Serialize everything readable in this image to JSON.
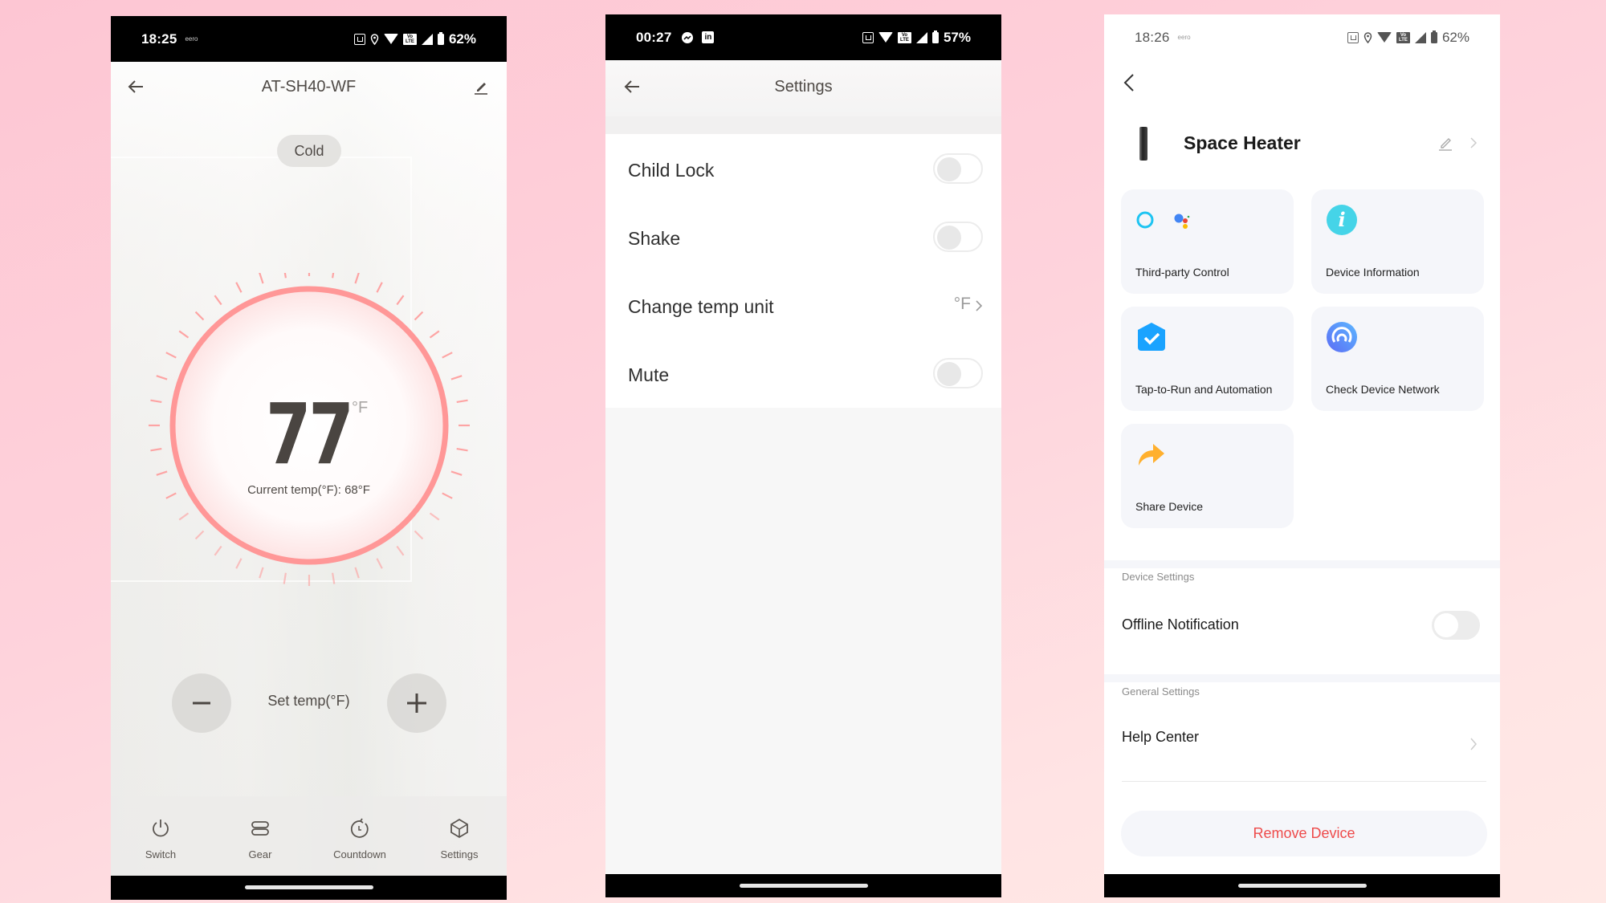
{
  "colors": {
    "accent_ring": "#ff9797",
    "danger": "#ee4a4a",
    "card_bg": "#f5f6fa"
  },
  "screens": [
    {
      "status_bar": {
        "time": "18:25",
        "carrier": "eero",
        "battery": "62%",
        "icons": [
          "nfc-icon",
          "location-icon",
          "wifi-icon",
          "volte-icon",
          "signal-icon",
          "battery-icon"
        ]
      },
      "header": {
        "title": "AT-SH40-WF",
        "back_icon": "back-arrow-icon",
        "edit_icon": "edit-pencil-icon"
      },
      "mode_badge": "Cold",
      "dial": {
        "set_temp": "77",
        "unit": "°F",
        "current_label": "Current temp(°F): 68°F",
        "set_temp_value": 77,
        "current_temp_value": 68
      },
      "controls": {
        "minus_icon": "minus-icon",
        "plus_icon": "plus-icon",
        "label": "Set temp(°F)"
      },
      "tabs": [
        {
          "label": "Switch",
          "icon": "power-icon"
        },
        {
          "label": "Gear",
          "icon": "gear-bars-icon"
        },
        {
          "label": "Countdown",
          "icon": "countdown-timer-icon"
        },
        {
          "label": "Settings",
          "icon": "cube-settings-icon"
        }
      ]
    },
    {
      "status_bar": {
        "time": "00:27",
        "battery": "57%",
        "icons": [
          "messenger-icon",
          "linkedin-icon",
          "nfc-icon",
          "wifi-icon",
          "volte-icon",
          "signal-icon",
          "battery-icon"
        ]
      },
      "header": {
        "title": "Settings",
        "back_icon": "back-arrow-icon"
      },
      "rows": [
        {
          "label": "Child Lock",
          "type": "toggle",
          "on": false
        },
        {
          "label": "Shake",
          "type": "toggle",
          "on": false
        },
        {
          "label": "Change temp unit",
          "type": "link",
          "value": "°F"
        },
        {
          "label": "Mute",
          "type": "toggle",
          "on": false
        }
      ]
    },
    {
      "status_bar": {
        "time": "18:26",
        "carrier": "eero",
        "battery": "62%",
        "icons": [
          "nfc-icon",
          "location-icon",
          "wifi-icon",
          "volte-icon",
          "signal-icon",
          "battery-icon"
        ]
      },
      "header": {
        "back_icon": "back-chevron-icon"
      },
      "device": {
        "name": "Space Heater",
        "edit_icon": "edit-pencil-icon",
        "chevron_icon": "chevron-right-icon"
      },
      "cards": [
        {
          "label": "Third-party Control",
          "icon": "alexa-google-assistant-icon"
        },
        {
          "label": "Device Information",
          "icon": "info-icon"
        },
        {
          "label": "Tap-to-Run and Automation",
          "icon": "automation-check-icon"
        },
        {
          "label": "Check Device Network",
          "icon": "network-signal-icon"
        },
        {
          "label": "Share Device",
          "icon": "share-arrow-icon"
        }
      ],
      "device_settings": {
        "section": "Device Settings",
        "offline_notification": {
          "label": "Offline Notification",
          "on": false
        }
      },
      "general_settings": {
        "section": "General Settings",
        "help_center": "Help Center"
      },
      "remove_button": "Remove Device"
    }
  ]
}
